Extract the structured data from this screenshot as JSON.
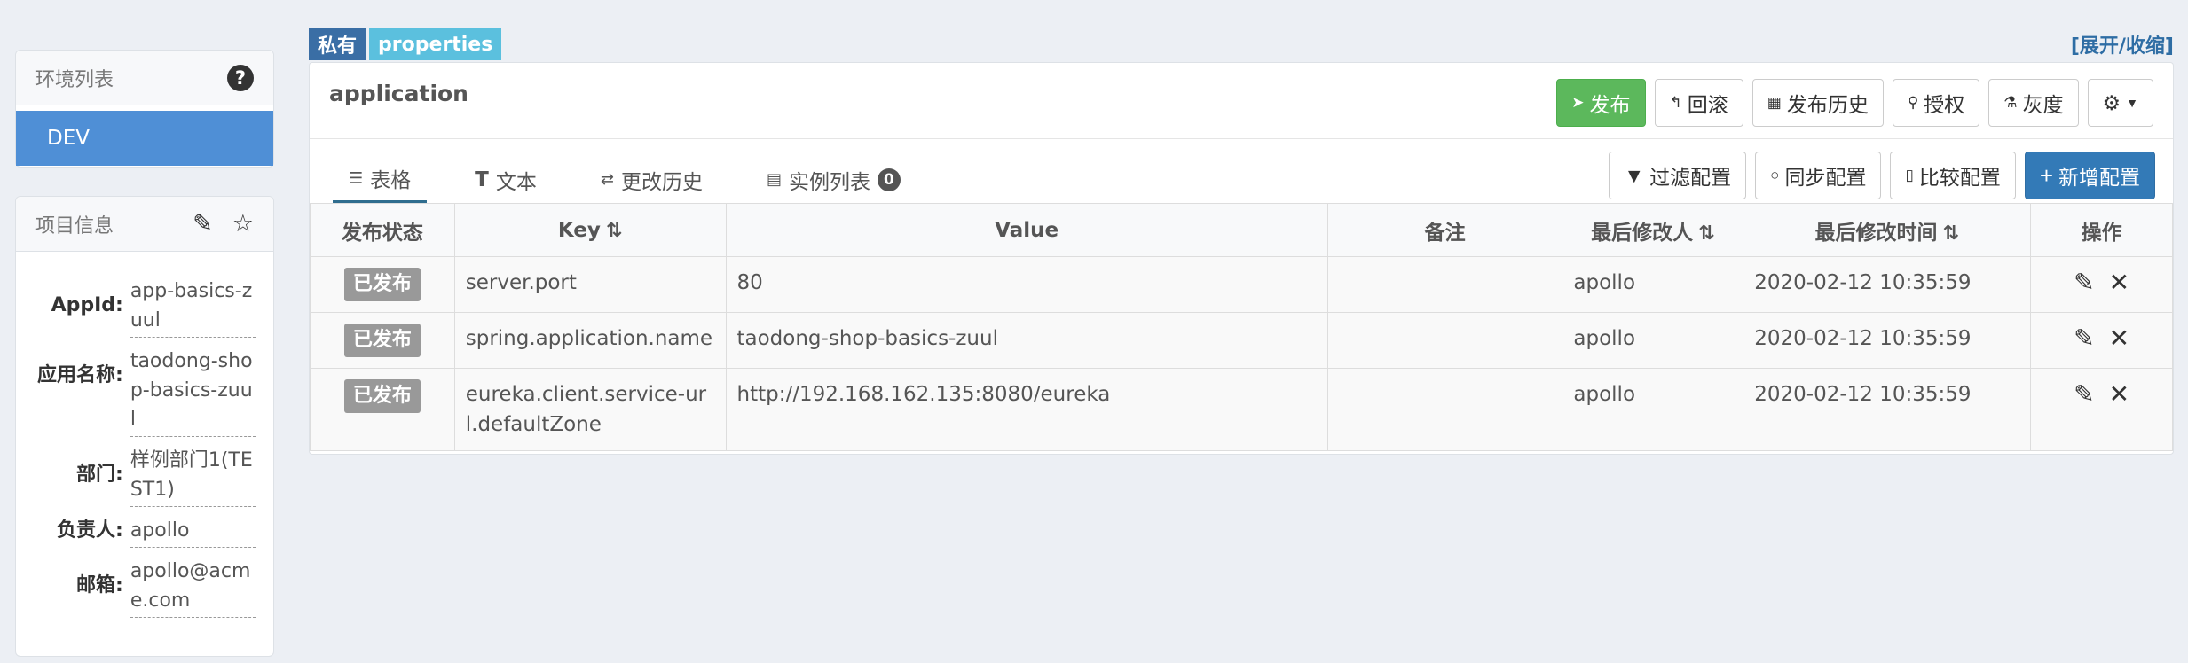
{
  "sidebar": {
    "env_title": "环境列表",
    "env_items": [
      "DEV"
    ],
    "project_title": "项目信息",
    "fields": [
      {
        "label": "AppId:",
        "value": "app-basics-zuul"
      },
      {
        "label": "应用名称:",
        "value": "taodong-shop-basics-zuul"
      },
      {
        "label": "部门:",
        "value": "样例部门1(TEST1)"
      },
      {
        "label": "负责人:",
        "value": "apollo"
      },
      {
        "label": "邮箱:",
        "value": "apollo@acme.com"
      }
    ]
  },
  "namespace": {
    "tag_scope": "私有",
    "tag_format": "properties",
    "expand_link": "[展开/收缩]",
    "title": "application",
    "actions": {
      "publish": "发布",
      "rollback": "回滚",
      "history": "发布历史",
      "grant": "授权",
      "gray": "灰度"
    },
    "tabs": {
      "table": "表格",
      "text": "文本",
      "history": "更改历史",
      "instances": "实例列表",
      "instances_count": "0"
    },
    "table_actions": {
      "filter": "过滤配置",
      "sync": "同步配置",
      "compare": "比较配置",
      "add": "新增配置"
    }
  },
  "table": {
    "headers": {
      "status": "发布状态",
      "key": "Key",
      "value": "Value",
      "comment": "备注",
      "modifier": "最后修改人",
      "time": "最后修改时间",
      "ops": "操作"
    },
    "rows": [
      {
        "status": "已发布",
        "key": "server.port",
        "value": "80",
        "comment": "",
        "modifier": "apollo",
        "time": "2020-02-12 10:35:59"
      },
      {
        "status": "已发布",
        "key": "spring.application.name",
        "value": "taodong-shop-basics-zuul",
        "comment": "",
        "modifier": "apollo",
        "time": "2020-02-12 10:35:59"
      },
      {
        "status": "已发布",
        "key": "eureka.client.service-url.defaultZone",
        "value": "http://192.168.162.135:8080/eureka",
        "comment": "",
        "modifier": "apollo",
        "time": "2020-02-12 10:35:59"
      }
    ]
  },
  "colors": {
    "primary": "#337ab7",
    "success": "#5cb85c",
    "env_active": "#4f8fd6",
    "tag_props": "#5bc0de"
  }
}
